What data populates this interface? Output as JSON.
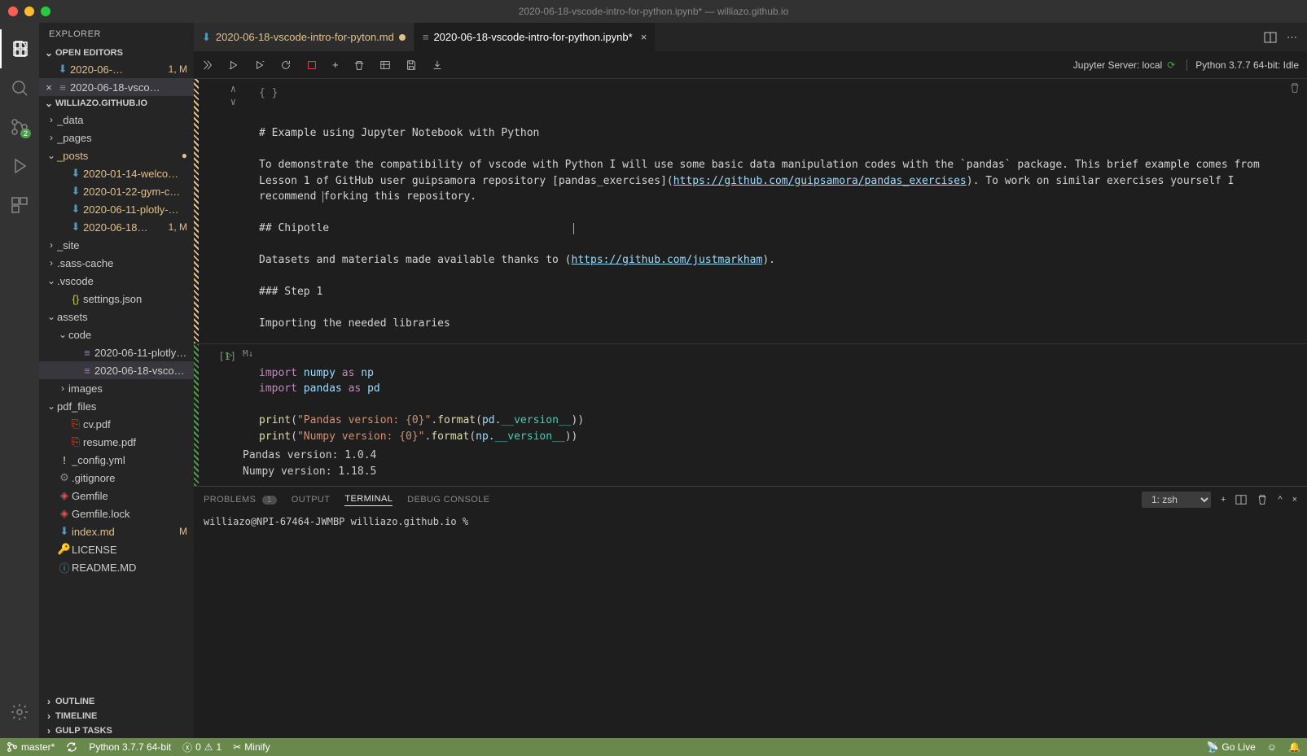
{
  "window": {
    "title": "2020-06-18-vscode-intro-for-python.ipynb* — williazo.github.io"
  },
  "sidebar": {
    "title": "EXPLORER",
    "open_editors_label": "OPEN EDITORS",
    "open_editors": [
      {
        "label": "2020-06-…",
        "suffix": "1, M",
        "modified": true,
        "dot": true
      },
      {
        "label": "2020-06-18-vsco…",
        "modified": false,
        "close": true,
        "selected": true
      }
    ],
    "workspace_label": "WILLIAZO.GITHUB.IO",
    "tree": [
      {
        "depth": 0,
        "chevron": ">",
        "label": "_data",
        "type": "folder"
      },
      {
        "depth": 0,
        "chevron": ">",
        "label": "_pages",
        "type": "folder"
      },
      {
        "depth": 0,
        "chevron": "v",
        "label": "_posts",
        "type": "folder",
        "modified": true,
        "suffix": "●"
      },
      {
        "depth": 1,
        "icon": "md",
        "label": "2020-01-14-welco…",
        "modified": true
      },
      {
        "depth": 1,
        "icon": "md",
        "label": "2020-01-22-gym-c…",
        "modified": true
      },
      {
        "depth": 1,
        "icon": "md",
        "label": "2020-06-11-plotly-…",
        "modified": true
      },
      {
        "depth": 1,
        "icon": "md",
        "label": "2020-06-18…",
        "modified": true,
        "suffix": "1, M"
      },
      {
        "depth": 0,
        "chevron": ">",
        "label": "_site",
        "type": "folder"
      },
      {
        "depth": 0,
        "chevron": ">",
        "label": ".sass-cache",
        "type": "folder"
      },
      {
        "depth": 0,
        "chevron": "v",
        "label": ".vscode",
        "type": "folder"
      },
      {
        "depth": 1,
        "icon": "json",
        "label": "settings.json"
      },
      {
        "depth": 0,
        "chevron": "v",
        "label": "assets",
        "type": "folder"
      },
      {
        "depth": 1,
        "chevron": "v",
        "label": "code",
        "type": "folder"
      },
      {
        "depth": 2,
        "icon": "nb",
        "label": "2020-06-11-plotly…"
      },
      {
        "depth": 2,
        "icon": "nb",
        "label": "2020-06-18-vsco…",
        "selected": true
      },
      {
        "depth": 1,
        "chevron": ">",
        "label": "images",
        "type": "folder"
      },
      {
        "depth": 0,
        "chevron": "v",
        "label": "pdf_files",
        "type": "folder"
      },
      {
        "depth": 1,
        "icon": "pdf",
        "label": "cv.pdf"
      },
      {
        "depth": 1,
        "icon": "pdf",
        "label": "resume.pdf"
      },
      {
        "depth": 0,
        "icon": "exclaim",
        "label": "_config.yml"
      },
      {
        "depth": 0,
        "icon": "gear",
        "label": ".gitignore"
      },
      {
        "depth": 0,
        "icon": "gem",
        "label": "Gemfile"
      },
      {
        "depth": 0,
        "icon": "gem",
        "label": "Gemfile.lock"
      },
      {
        "depth": 0,
        "icon": "md",
        "label": "index.md",
        "modified": true,
        "suffix": "M"
      },
      {
        "depth": 0,
        "icon": "lic",
        "label": "LICENSE"
      },
      {
        "depth": 0,
        "icon": "info",
        "label": "README.MD"
      }
    ],
    "outline_label": "OUTLINE",
    "timeline_label": "TIMELINE",
    "gulptasks_label": "GULP TASKS"
  },
  "tabs": [
    {
      "label": "2020-06-18-vscode-intro-for-pyton.md",
      "modified": true,
      "active": false,
      "dirty": true
    },
    {
      "label": "2020-06-18-vscode-intro-for-python.ipynb*",
      "modified": false,
      "active": true,
      "dirty": false
    }
  ],
  "notebook": {
    "jupyter_server": "Jupyter Server: local",
    "kernel": "Python 3.7.7 64-bit: Idle",
    "markdown_cell": {
      "braces": "{ }",
      "text": "# Example using Jupyter Notebook with Python\n\nTo demonstrate the compatibility of vscode with Python I will use some basic data manipulation codes with the `pandas` package. This brief example comes from Lesson 1 of GitHub user guipsamora repository [pandas_exercises](https://github.com/guipsamora/pandas_exercises). To work on similar exercises yourself I recommend forking this repository.\n\n## Chipotle\n\nDatasets and materials made available thanks to (https://github.com/justmarkham).\n\n### Step 1\n\nImporting the needed libraries",
      "link1": "https://github.com/guipsamora/pandas_exercises",
      "link2": "https://github.com/justmarkham"
    },
    "code_cell": {
      "exec_count": "[1]",
      "markdown_toggle": "M↓",
      "output": "Pandas version: 1.0.4\nNumpy version: 1.18.5"
    }
  },
  "panel": {
    "tabs": {
      "problems": "PROBLEMS",
      "problems_count": "1",
      "output": "OUTPUT",
      "terminal": "TERMINAL",
      "debug": "DEBUG CONSOLE"
    },
    "term_select": "1: zsh",
    "prompt": "williazo@NPI-67464-JWMBP williazo.github.io % "
  },
  "statusbar": {
    "branch": "master*",
    "python": "Python 3.7.7 64-bit",
    "errors": "0",
    "warnings": "1",
    "minify": "Minify",
    "golive": "Go Live"
  },
  "scm_badge": "2"
}
